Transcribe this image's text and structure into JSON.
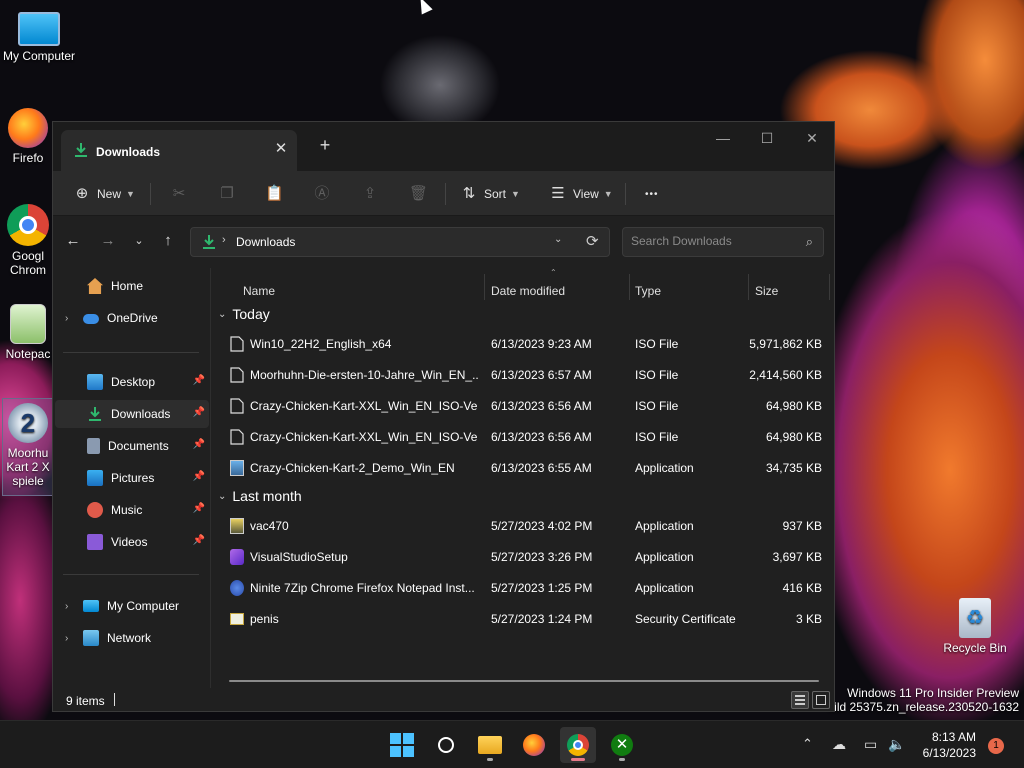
{
  "desktop": {
    "icons": [
      {
        "label": "My Computer"
      },
      {
        "label": "Firefo"
      },
      {
        "label": "Googl Chrom"
      },
      {
        "label": "Notepac"
      },
      {
        "label": "Moorhu Kart 2 X spiele"
      },
      {
        "label": "Recycle Bin"
      }
    ],
    "watermark_line1": "Windows 11 Pro Insider Preview",
    "watermark_line2": "uild 25375.zn_release.230520-1632"
  },
  "window": {
    "tab_title": "Downloads",
    "new_tab_label": "+",
    "controls": {
      "minimize": "—",
      "maximize": "☐",
      "close": "✕"
    },
    "toolbar": {
      "new_label": "New",
      "sort_label": "Sort",
      "view_label": "View",
      "more_label": "•••"
    },
    "address": {
      "path": "Downloads",
      "search_placeholder": "Search Downloads"
    },
    "sidebar": {
      "home": "Home",
      "onedrive": "OneDrive",
      "desktop": "Desktop",
      "downloads": "Downloads",
      "documents": "Documents",
      "pictures": "Pictures",
      "music": "Music",
      "videos": "Videos",
      "mycomputer": "My Computer",
      "network": "Network"
    },
    "columns": {
      "name": "Name",
      "date": "Date modified",
      "type": "Type",
      "size": "Size"
    },
    "groups": [
      {
        "label": "Today",
        "files": [
          {
            "name": "Win10_22H2_English_x64",
            "date": "6/13/2023 9:23 AM",
            "type": "ISO File",
            "size": "5,971,862 KB",
            "icon": "document-icon"
          },
          {
            "name": "Moorhuhn-Die-ersten-10-Jahre_Win_EN_...",
            "date": "6/13/2023 6:57 AM",
            "type": "ISO File",
            "size": "2,414,560 KB",
            "icon": "document-icon"
          },
          {
            "name": "Crazy-Chicken-Kart-XXL_Win_EN_ISO-Ve...",
            "date": "6/13/2023 6:56 AM",
            "type": "ISO File",
            "size": "64,980 KB",
            "icon": "document-icon"
          },
          {
            "name": "Crazy-Chicken-Kart-XXL_Win_EN_ISO-Ve...",
            "date": "6/13/2023 6:56 AM",
            "type": "ISO File",
            "size": "64,980 KB",
            "icon": "document-icon"
          },
          {
            "name": "Crazy-Chicken-Kart-2_Demo_Win_EN",
            "date": "6/13/2023 6:55 AM",
            "type": "Application",
            "size": "34,735 KB",
            "icon": "application-icon"
          }
        ]
      },
      {
        "label": "Last month",
        "files": [
          {
            "name": "vac470",
            "date": "5/27/2023 4:02 PM",
            "type": "Application",
            "size": "937 KB",
            "icon": "application-icon"
          },
          {
            "name": "VisualStudioSetup",
            "date": "5/27/2023 3:26 PM",
            "type": "Application",
            "size": "3,697 KB",
            "icon": "visual-studio-icon"
          },
          {
            "name": "Ninite 7Zip Chrome Firefox Notepad Inst...",
            "date": "5/27/2023 1:25 PM",
            "type": "Application",
            "size": "416 KB",
            "icon": "ninite-icon"
          },
          {
            "name": "penis",
            "date": "5/27/2023 1:24 PM",
            "type": "Security Certificate",
            "size": "3 KB",
            "icon": "certificate-icon"
          }
        ]
      }
    ],
    "status_count": "9 items"
  },
  "taskbar": {
    "time": "8:13 AM",
    "date": "6/13/2023",
    "notifications": "1"
  }
}
